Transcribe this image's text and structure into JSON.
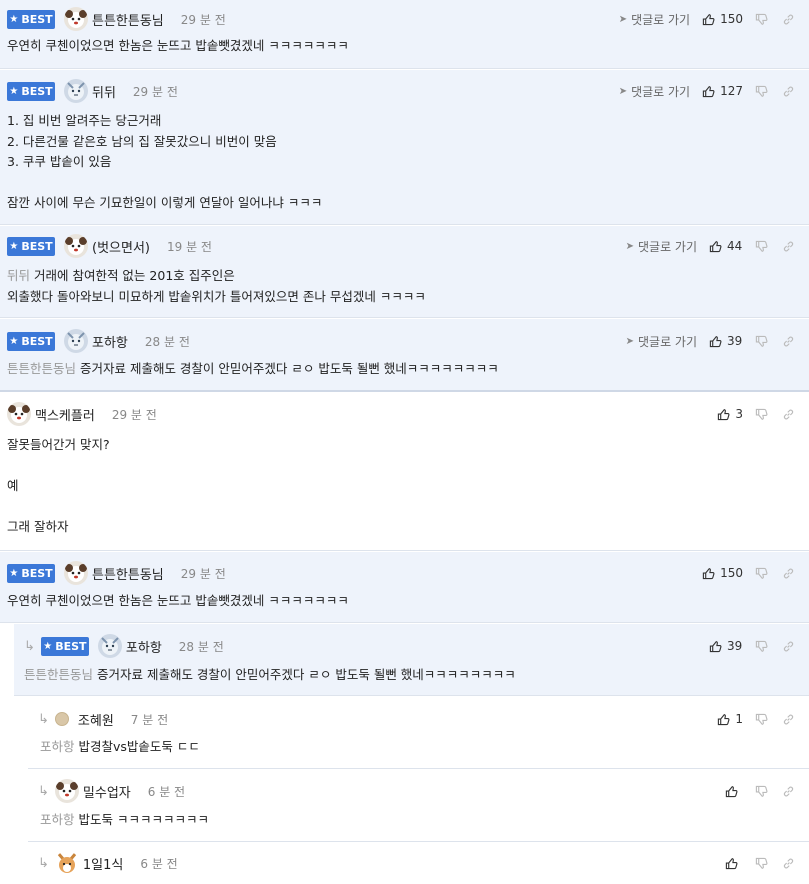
{
  "labels": {
    "best": "BEST",
    "reply_link": "댓글로 가기"
  },
  "colors": {
    "best_badge": "#3b78d8",
    "best_bg": "#eef3fb",
    "mention": "#999999"
  },
  "icons": [
    "star-icon",
    "reply-arrow-icon",
    "thumbs-up-icon",
    "thumbs-down-icon",
    "link-icon",
    "nested-reply-icon"
  ],
  "comments": [
    {
      "best": true,
      "nick": "튼튼한튼동님",
      "time": "29 분 전",
      "upvotes": "150",
      "body": "우연히 쿠첸이었으면 한놈은 눈뜨고 밥솥뺏겼겠네 ㅋㅋㅋㅋㅋㅋㅋ"
    },
    {
      "best": true,
      "nick": "뒤뒤",
      "time": "29 분 전",
      "upvotes": "127",
      "body": "1. 집 비번 알려주는 당근거래\n2. 다른건물 같은호 남의 집 잘못갔으니 비번이 맞음\n3. 쿠쿠 밥솥이 있음\n\n잠깐 사이에 무슨 기묘한일이 이렇게 연달아 일어나냐 ㅋㅋㅋ"
    },
    {
      "best": true,
      "nick": "(벗으면서)",
      "time": "19 분 전",
      "upvotes": "44",
      "mention": "뒤뒤",
      "body": " 거래에 참여한적 없는 201호 집주인은\n외출했다 돌아와보니 미묘하게 밥솥위치가 틀어져있으면 존나 무섭겠네 ㅋㅋㅋㅋ"
    },
    {
      "best": true,
      "nick": "포하항",
      "time": "28 분 전",
      "upvotes": "39",
      "mention": "튼튼한튼동님",
      "body": " 증거자료 제출해도 경찰이 안믿어주겠다 ㄹㅇ 밥도둑 될뻔 했네ㅋㅋㅋㅋㅋㅋㅋㅋ"
    },
    {
      "best": false,
      "nick": "맥스케플러",
      "time": "29 분 전",
      "upvotes": "3",
      "body": "잘못들어간거 맞지?\n\n예\n\n그래 잘하자"
    },
    {
      "best": true,
      "nick": "튼튼한튼동님",
      "time": "29 분 전",
      "upvotes": "150",
      "body": "우연히 쿠첸이었으면 한놈은 눈뜨고 밥솥뺏겼겠네 ㅋㅋㅋㅋㅋㅋㅋ"
    },
    {
      "best": true,
      "nick": "포하항",
      "time": "28 분 전",
      "upvotes": "39",
      "mention": "튼튼한튼동님",
      "body": " 증거자료 제출해도 경찰이 안믿어주겠다 ㄹㅇ 밥도둑 될뻔 했네ㅋㅋㅋㅋㅋㅋㅋㅋ"
    },
    {
      "best": false,
      "nick": "조혜원",
      "time": "7 분 전",
      "upvotes": "1",
      "mention": "포하항",
      "body": " 밥경찰vs밥솥도둑 ㄷㄷ"
    },
    {
      "best": false,
      "nick": "밀수업자",
      "time": "6 분 전",
      "upvotes": "",
      "mention": "포하항",
      "body": " 밥도둑 ㅋㅋㅋㅋㅋㅋㅋㅋ"
    },
    {
      "best": false,
      "nick": "1일1식",
      "time": "6 분 전",
      "upvotes": ""
    }
  ]
}
